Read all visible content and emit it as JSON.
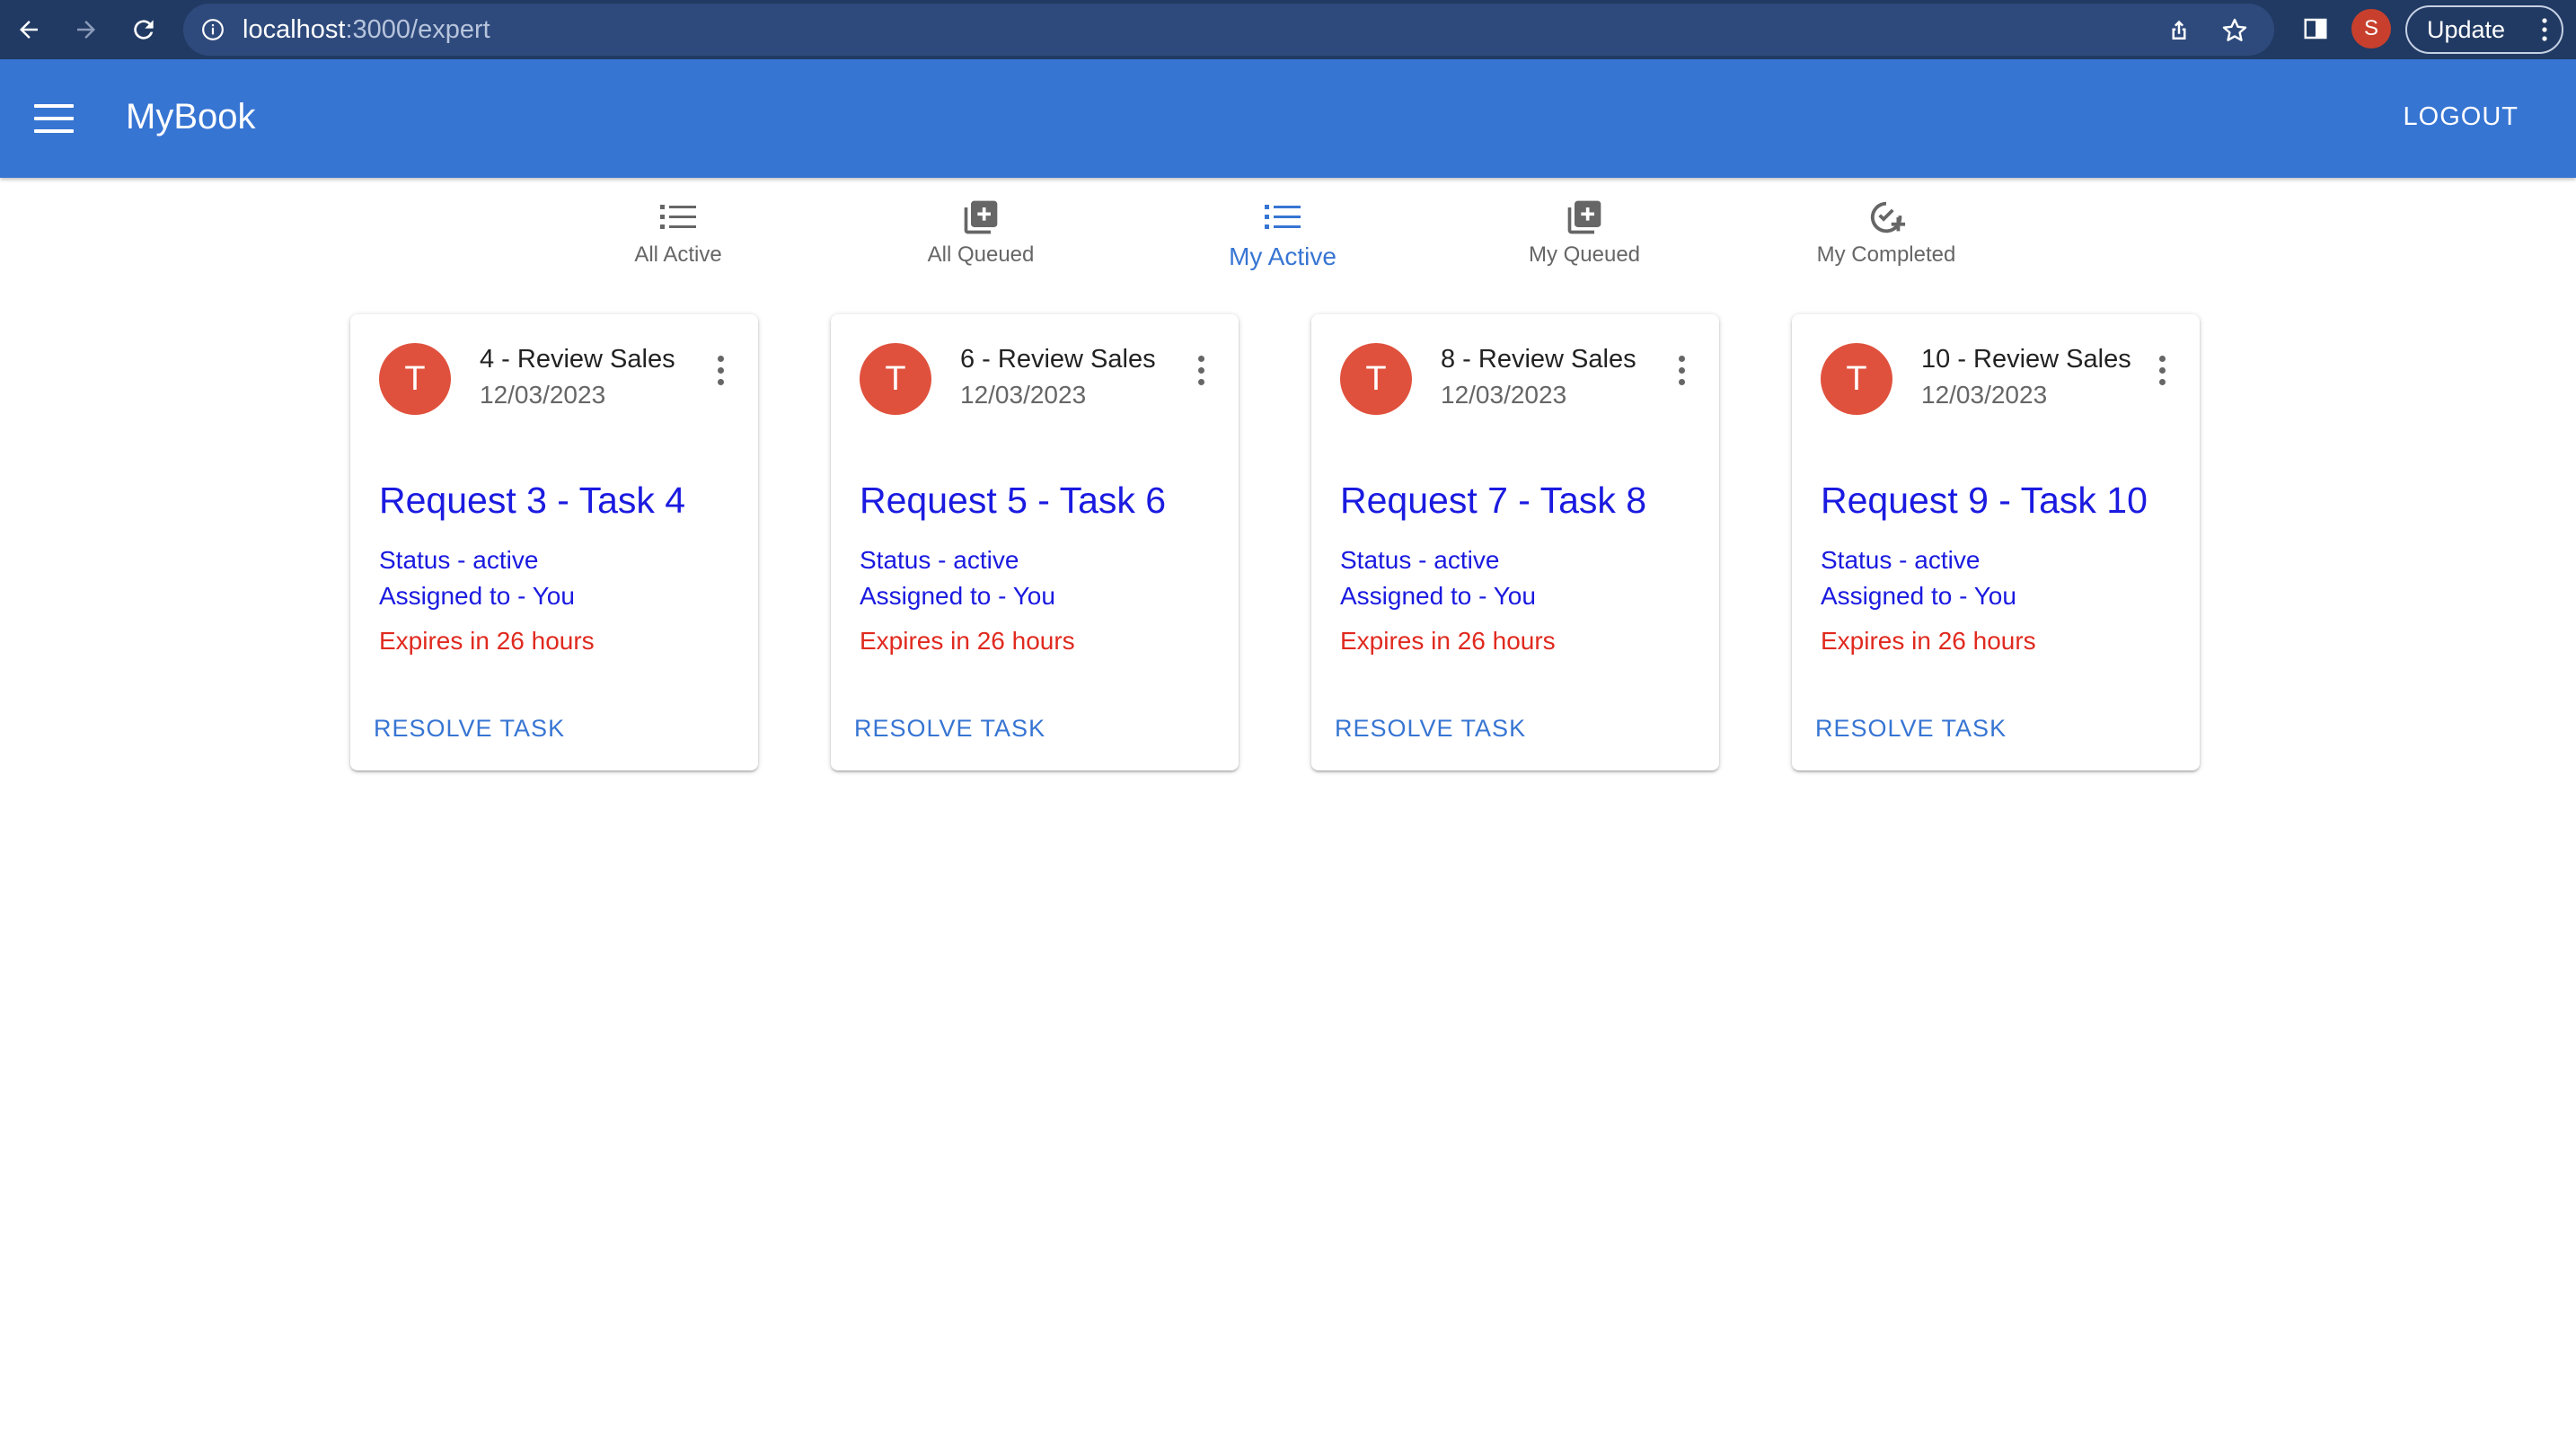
{
  "browser": {
    "url_host": "localhost",
    "url_path": ":3000/expert",
    "profile_initial": "S",
    "update_label": "Update"
  },
  "appbar": {
    "title": "MyBook",
    "logout_label": "LOGOUT"
  },
  "tabs": [
    {
      "label": "All Active",
      "icon": "list-icon",
      "active": false
    },
    {
      "label": "All Queued",
      "icon": "library-add-icon",
      "active": false
    },
    {
      "label": "My Active",
      "icon": "list-icon",
      "active": true
    },
    {
      "label": "My Queued",
      "icon": "library-add-icon",
      "active": false
    },
    {
      "label": "My Completed",
      "icon": "check-circle-add-icon",
      "active": false
    }
  ],
  "cards": [
    {
      "avatar": "T",
      "title": "4 - Review Sales",
      "date": "12/03/2023",
      "heading": "Request 3 - Task 4",
      "status": "Status - active",
      "assigned": "Assigned to - You",
      "expires": "Expires in 26 hours",
      "action": "RESOLVE TASK"
    },
    {
      "avatar": "T",
      "title": "6 - Review Sales",
      "date": "12/03/2023",
      "heading": "Request 5 - Task 6",
      "status": "Status - active",
      "assigned": "Assigned to - You",
      "expires": "Expires in 26 hours",
      "action": "RESOLVE TASK"
    },
    {
      "avatar": "T",
      "title": "8 - Review Sales",
      "date": "12/03/2023",
      "heading": "Request 7 - Task 8",
      "status": "Status - active",
      "assigned": "Assigned to - You",
      "expires": "Expires in 26 hours",
      "action": "RESOLVE TASK"
    },
    {
      "avatar": "T",
      "title": "10 - Review Sales",
      "date": "12/03/2023",
      "heading": "Request 9 - Task 10",
      "status": "Status - active",
      "assigned": "Assigned to - You",
      "expires": "Expires in 26 hours",
      "action": "RESOLVE TASK"
    }
  ],
  "colors": {
    "appbar": "#3775d3",
    "chrome": "#213a63",
    "avatar": "#e0513d",
    "link_blue": "#1a1ae0",
    "expires_red": "#e02a1f"
  }
}
